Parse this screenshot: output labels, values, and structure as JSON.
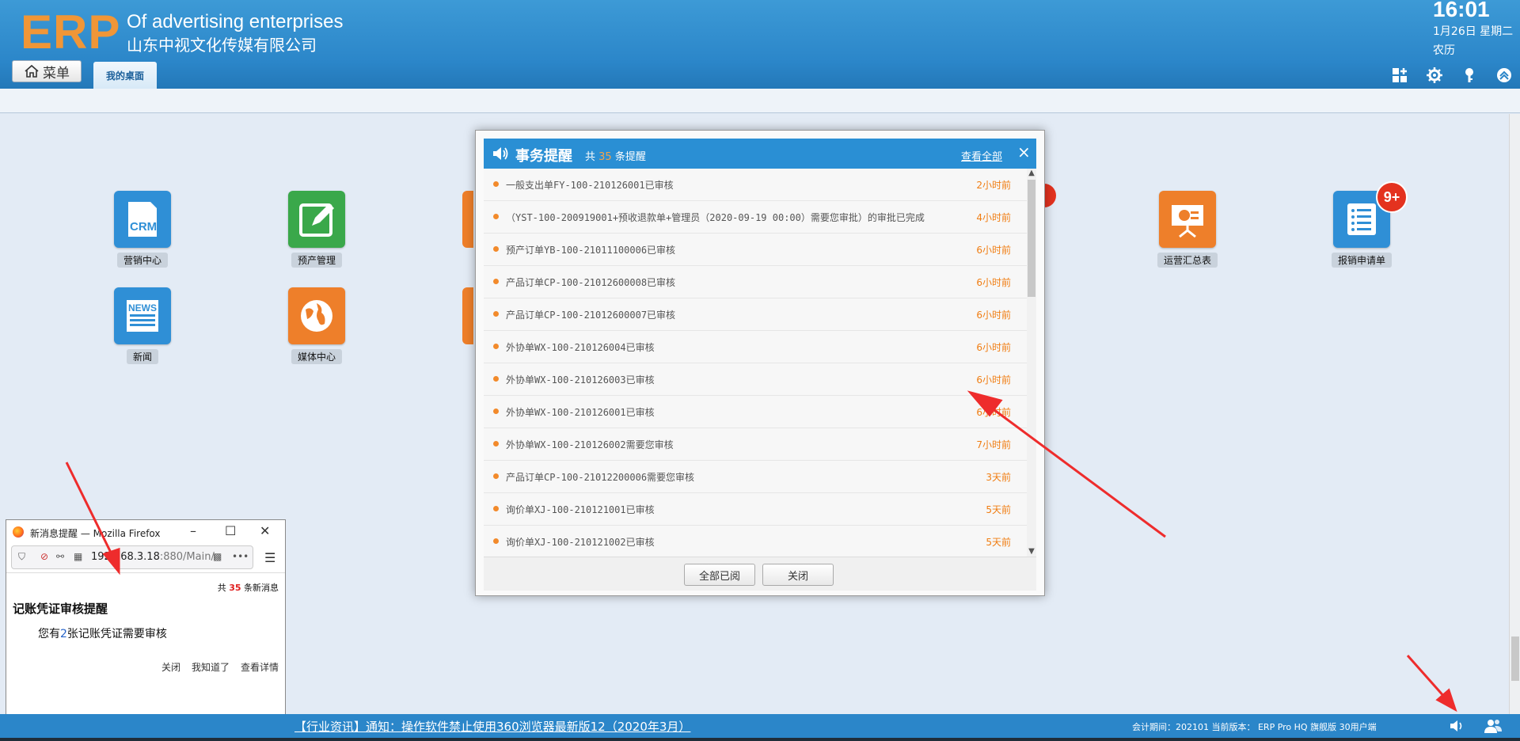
{
  "header": {
    "logo": "ERP",
    "company_en": "Of advertising enterprises",
    "company_cn": "山东中视文化传媒有限公司",
    "time": "16:01",
    "date": "1月26日 星期二",
    "lunar": "农历",
    "menu_label": "菜单",
    "tab_label": "我的桌面",
    "icons": [
      "layout-icon",
      "gear-icon",
      "key-icon",
      "collapse-icon"
    ]
  },
  "desktop": {
    "icons": [
      {
        "label": "营销中心",
        "icon": "crm-icon",
        "color": "#2f8fd6"
      },
      {
        "label": "预产管理",
        "icon": "edit-icon",
        "color": "#3aa84a"
      },
      {
        "label": "运营汇总表",
        "icon": "presentation-icon",
        "color": "#ee7f2a"
      },
      {
        "label": "报销申请单",
        "icon": "list-icon",
        "color": "#2f8fd6",
        "badge": "9+"
      },
      {
        "label": "新闻",
        "icon": "news-icon",
        "color": "#2f8fd6"
      },
      {
        "label": "媒体中心",
        "icon": "globe-icon",
        "color": "#ee7f2a"
      }
    ]
  },
  "reminder": {
    "title": "事务提醒",
    "count_prefix": "共",
    "count": "35",
    "count_suffix": "条提醒",
    "view_all": "查看全部",
    "close_x": "×",
    "items": [
      {
        "text": "一般支出单FY-100-210126001已审核",
        "time": "2小时前"
      },
      {
        "text": "（YST-100-200919001+预收退款单+管理员（2020-09-19 00:00）需要您审批）的审批已完成",
        "time": "4小时前"
      },
      {
        "text": "预产订单YB-100-21011100006已审核",
        "time": "6小时前"
      },
      {
        "text": "产品订单CP-100-21012600008已审核",
        "time": "6小时前"
      },
      {
        "text": "产品订单CP-100-21012600007已审核",
        "time": "6小时前"
      },
      {
        "text": "外协单WX-100-210126004已审核",
        "time": "6小时前"
      },
      {
        "text": "外协单WX-100-210126003已审核",
        "time": "6小时前"
      },
      {
        "text": "外协单WX-100-210126001已审核",
        "time": "6小时前"
      },
      {
        "text": "外协单WX-100-210126002需要您审核",
        "time": "7小时前"
      },
      {
        "text": "产品订单CP-100-21012200006需要您审核",
        "time": "3天前"
      },
      {
        "text": "询价单XJ-100-210121001已审核",
        "time": "5天前"
      },
      {
        "text": "询价单XJ-100-210121002已审核",
        "time": "5天前"
      }
    ],
    "btn_read_all": "全部已阅",
    "btn_close": "关闭"
  },
  "popup": {
    "window_title": "新消息提醒 — Mozilla Firefox",
    "url_host": "192.168.3.18",
    "url_rest": ":880/Main/",
    "total_prefix": "共",
    "total": "35",
    "total_suffix": "条新消息",
    "heading": "记账凭证审核提醒",
    "msg_prefix": "您有",
    "msg_num": "2",
    "msg_suffix": "张记账凭证需要审核",
    "actions": [
      "关闭",
      "我知道了",
      "查看详情"
    ]
  },
  "footer": {
    "news": "【行业资讯】通知：操作软件禁止使用360浏览器最新版12（2020年3月）",
    "info": "会计期间：202101 当前版本： ERP Pro HQ 旗舰版 30用户端"
  }
}
